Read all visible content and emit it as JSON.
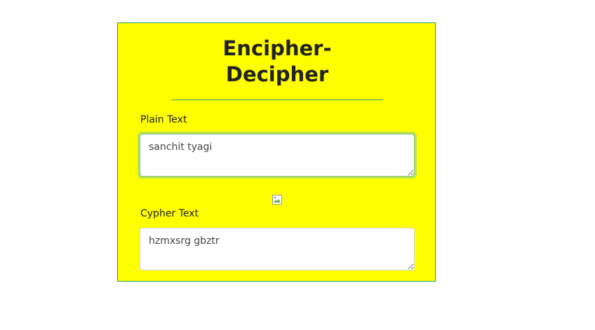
{
  "app": {
    "title_line1": "Encipher-",
    "title_line2": "Decipher"
  },
  "plain": {
    "label": "Plain Text",
    "value": "sanchit tyagi"
  },
  "cypher": {
    "label": "Cypher Text",
    "value": "hzmxsrg gbztr"
  },
  "colors": {
    "card_background": "#ffff00",
    "card_border": "#1f9e6f",
    "focus_ring": "#86c48c"
  },
  "icons": {
    "convert": "broken-image-icon"
  }
}
